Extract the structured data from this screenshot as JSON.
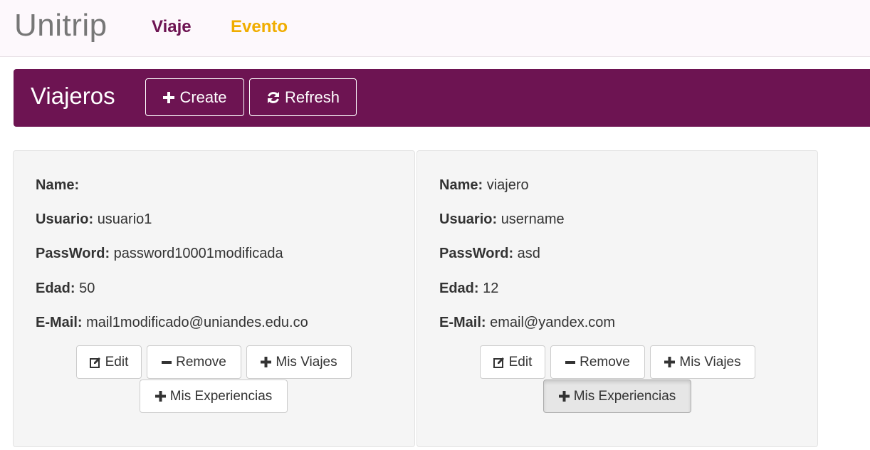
{
  "navbar": {
    "brand": "Unitrip",
    "links": [
      {
        "label": "Viaje",
        "color": "#6d1452"
      },
      {
        "label": "Evento",
        "color": "#f0ad00"
      }
    ]
  },
  "header": {
    "title": "Viajeros",
    "background": "#6d1452",
    "buttons": {
      "create": {
        "label": "Create",
        "icon": "plus-icon"
      },
      "refresh": {
        "label": "Refresh",
        "icon": "refresh-icon"
      }
    }
  },
  "viajeros": [
    {
      "fields": {
        "name": {
          "label": "Name:",
          "value": ""
        },
        "usuario": {
          "label": "Usuario:",
          "value": "usuario1"
        },
        "password": {
          "label": "PassWord:",
          "value": "password10001modificada"
        },
        "edad": {
          "label": "Edad:",
          "value": "50"
        },
        "email": {
          "label": "E-Mail:",
          "value": "mail1modificado@uniandes.edu.co"
        }
      },
      "actions": {
        "edit": {
          "label": "Edit",
          "icon": "edit-icon"
        },
        "remove": {
          "label": "Remove",
          "icon": "minus-icon"
        },
        "mis_viajes": {
          "label": "Mis Viajes",
          "icon": "plus-icon"
        },
        "mis_experiencias": {
          "label": "Mis Experiencias",
          "icon": "plus-icon",
          "active": false
        }
      }
    },
    {
      "fields": {
        "name": {
          "label": "Name:",
          "value": "viajero"
        },
        "usuario": {
          "label": "Usuario:",
          "value": "username"
        },
        "password": {
          "label": "PassWord:",
          "value": "asd"
        },
        "edad": {
          "label": "Edad:",
          "value": "12"
        },
        "email": {
          "label": "E-Mail:",
          "value": "email@yandex.com"
        }
      },
      "actions": {
        "edit": {
          "label": "Edit",
          "icon": "edit-icon"
        },
        "remove": {
          "label": "Remove",
          "icon": "minus-icon"
        },
        "mis_viajes": {
          "label": "Mis Viajes",
          "icon": "plus-icon"
        },
        "mis_experiencias": {
          "label": "Mis Experiencias",
          "icon": "plus-icon",
          "active": true
        }
      }
    }
  ]
}
